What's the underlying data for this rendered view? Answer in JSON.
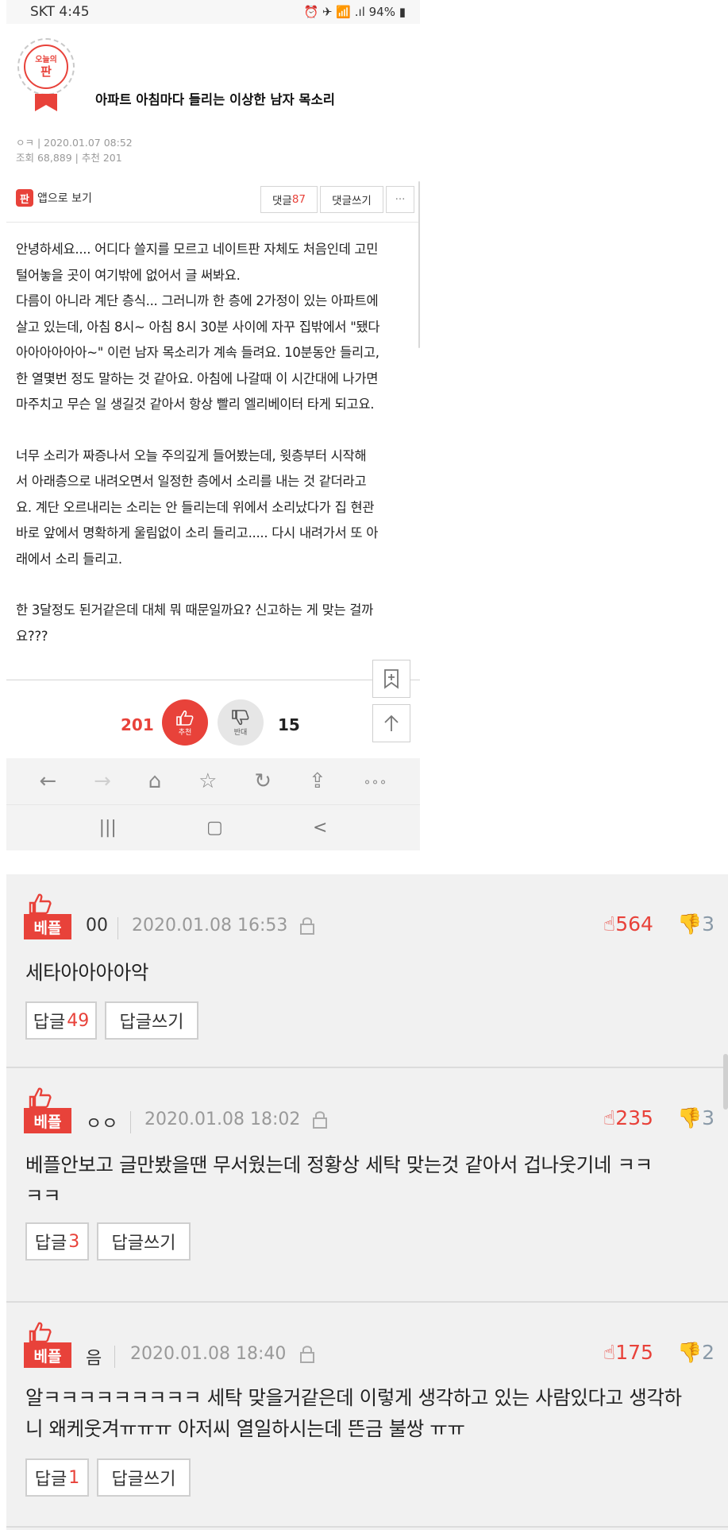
{
  "status_bar": {
    "carrier_time": "SKT 4:45",
    "indicators": "⏰ ✈ 📶 .ıl 94% ▮"
  },
  "post": {
    "badge_top": "오늘의",
    "badge_main": "판",
    "title": "아파트 아침마다 들리는 이상한 남자 목소리",
    "author_date": "ㅇㅋ  |  2020.01.07 08:52",
    "stats": "조회 68,889  |  추천 201",
    "app_view_icon": "판",
    "app_view_label": "앱으로 보기",
    "comments_label": "댓글",
    "comments_count": "87",
    "write_comment_label": "댓글쓰기",
    "more_label": "···",
    "body": [
      "안녕하세요.... 어디다 쓸지를 모르고 네이트판 자체도 처음인데 고민",
      "털어놓을 곳이 여기밖에 없어서 글 써봐요.",
      "다름이 아니라 계단 층식... 그러니까 한 층에 2가정이 있는 아파트에",
      "살고 있는데, 아침 8시~ 아침 8시 30분 사이에 자꾸 집밖에서 \"됐다",
      "아아아아아아~\" 이런 남자 목소리가 계속 들려요. 10분동안 들리고,",
      "한 열몇번 정도 말하는 것 같아요. 아침에 나갈때 이 시간대에 나가면",
      "마주치고 무슨 일 생길것 같아서 항상 빨리 엘리베이터 타게 되고요.",
      "",
      "너무 소리가 짜증나서 오늘 주의깊게 들어봤는데, 윗층부터 시작해",
      "서 아래층으로 내려오면서 일정한 층에서 소리를 내는 것 같더라고",
      "요. 계단 오르내리는 소리는 안 들리는데 위에서 소리났다가 집 현관",
      "바로 앞에서 명확하게 울림없이 소리 들리고..... 다시 내려가서 또 아",
      "래에서 소리 들리고.",
      "",
      "한 3달정도 된거같은데 대체 뭐 때문일까요? 신고하는 게 맞는 걸까",
      "요???"
    ],
    "upvotes": "201",
    "upvote_label": "추천",
    "downvote_label": "반대",
    "downvotes": "15"
  },
  "browser": {
    "back": "←",
    "forward": "→",
    "home": "⌂",
    "bookmark": "☆",
    "reload": "↻",
    "share": "⇪",
    "menu": "∘∘∘"
  },
  "android_nav": {
    "recents": "|||",
    "home": "▢",
    "back": "<"
  },
  "comments": [
    {
      "tag": "베플",
      "author": "00",
      "date": "2020.01.08 16:53",
      "likes": "564",
      "dislikes": "3",
      "text": [
        "세타아아아아악"
      ],
      "reply_label": "답글",
      "reply_count": "49",
      "write_reply_label": "답글쓰기"
    },
    {
      "tag": "베플",
      "author": "ㅇㅇ",
      "date": "2020.01.08 18:02",
      "likes": "235",
      "dislikes": "3",
      "text": [
        "베플안보고 글만봤을땐 무서웠는데 정황상 세탁 맞는것 같아서 겁나웃기네 ㅋㅋ",
        "ㅋㅋ"
      ],
      "reply_label": "답글",
      "reply_count": "3",
      "write_reply_label": "답글쓰기"
    },
    {
      "tag": "베플",
      "author": "음",
      "date": "2020.01.08 18:40",
      "likes": "175",
      "dislikes": "2",
      "text": [
        "알ㅋㅋㅋㅋㅋㅋㅋㅋㅋ 세탁 맞을거같은데 이렇게 생각하고 있는 사람있다고 생각하",
        "니 왜케웃겨ㅠㅠㅠ 아저씨 열일하시는데 뜬금 불쌍 ㅠㅠ"
      ],
      "reply_label": "답글",
      "reply_count": "1",
      "write_reply_label": "답글쓰기"
    }
  ]
}
